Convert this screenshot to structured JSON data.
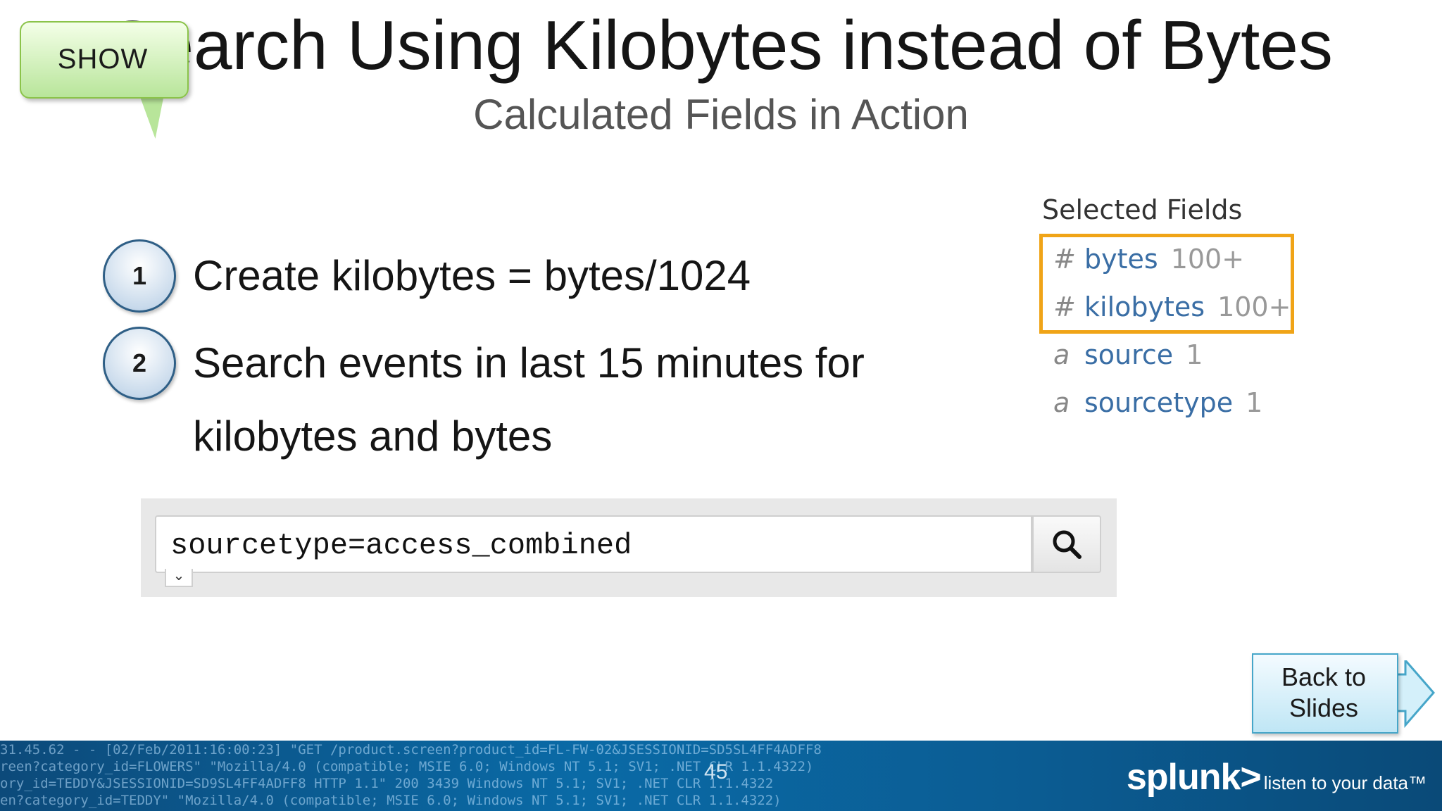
{
  "slide": {
    "title": "Search Using Kilobytes instead of Bytes",
    "subtitle": "Calculated Fields in Action",
    "page_number": "45"
  },
  "show_button": {
    "label": "SHOW"
  },
  "steps": [
    {
      "number": "1",
      "text": "Create kilobytes = bytes/1024"
    },
    {
      "number": "2",
      "text": "Search events in last 15 minutes for kilobytes and bytes"
    }
  ],
  "selected_fields": {
    "heading": "Selected Fields",
    "items": [
      {
        "type": "#",
        "name": "bytes",
        "count": "100+"
      },
      {
        "type": "#",
        "name": "kilobytes",
        "count": "100+"
      },
      {
        "type": "a",
        "name": "source",
        "count": "1"
      },
      {
        "type": "a",
        "name": "sourcetype",
        "count": "1"
      }
    ]
  },
  "search": {
    "query": "sourcetype=access_combined",
    "icons": {
      "submit": "search-icon",
      "expand": "chevron-down-icon"
    }
  },
  "back_button": {
    "label": "Back to Slides"
  },
  "footer": {
    "log_lines": [
      "31.45.62 - - [02/Feb/2011:16:00:23] \"GET /product.screen?product_id=FL-FW-02&JSESSIONID=SD5SL4FF4ADFF8",
      "reen?category_id=FLOWERS\" \"Mozilla/4.0 (compatible; MSIE 6.0; Windows NT 5.1; SV1; .NET CLR 1.1.4322)",
      "ory_id=TEDDY&JSESSIONID=SD9SL4FF4ADFF8 HTTP 1.1\" 200 3439 Windows NT 5.1; SV1; .NET CLR 1.1.4322",
      "en?category_id=TEDDY\" \"Mozilla/4.0 (compatible; MSIE 6.0; Windows NT 5.1; SV1; .NET CLR 1.1.4322)"
    ],
    "brand": "splunk>",
    "tagline": "listen to your data™"
  },
  "colors": {
    "highlight_border": "#f0a417",
    "field_name": "#3a6ea5",
    "footer": "#0a6aa6"
  }
}
